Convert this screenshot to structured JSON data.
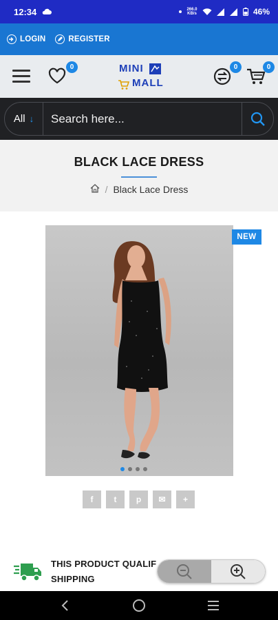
{
  "status_bar": {
    "time": "12:34",
    "net_speed_value": "266.0",
    "net_speed_unit": "KB/s",
    "battery": "46%"
  },
  "auth": {
    "login_label": "LOGIN",
    "register_label": "REGISTER"
  },
  "header": {
    "logo_line1": "MINI",
    "logo_line2": "MALL",
    "wishlist_count": "0",
    "compare_count": "0",
    "cart_count": "0"
  },
  "search": {
    "category": "All",
    "placeholder": "Search here..."
  },
  "page": {
    "title": "BLACK LACE DRESS",
    "breadcrumb_current": "Black Lace Dress",
    "breadcrumb_sep": "/"
  },
  "product": {
    "badge": "NEW",
    "image_dots": 4,
    "active_dot": 0
  },
  "share": {
    "facebook": "f",
    "twitter": "t",
    "pinterest": "p",
    "email": "✉",
    "more": "+"
  },
  "shipping": {
    "line1": "THIS PRODUCT QUALIF",
    "line2": "SHIPPING"
  },
  "colors": {
    "status_bar": "#1f2bc4",
    "auth_bar": "#1976d2",
    "accent": "#1e88e5",
    "search_bg": "#202124"
  }
}
